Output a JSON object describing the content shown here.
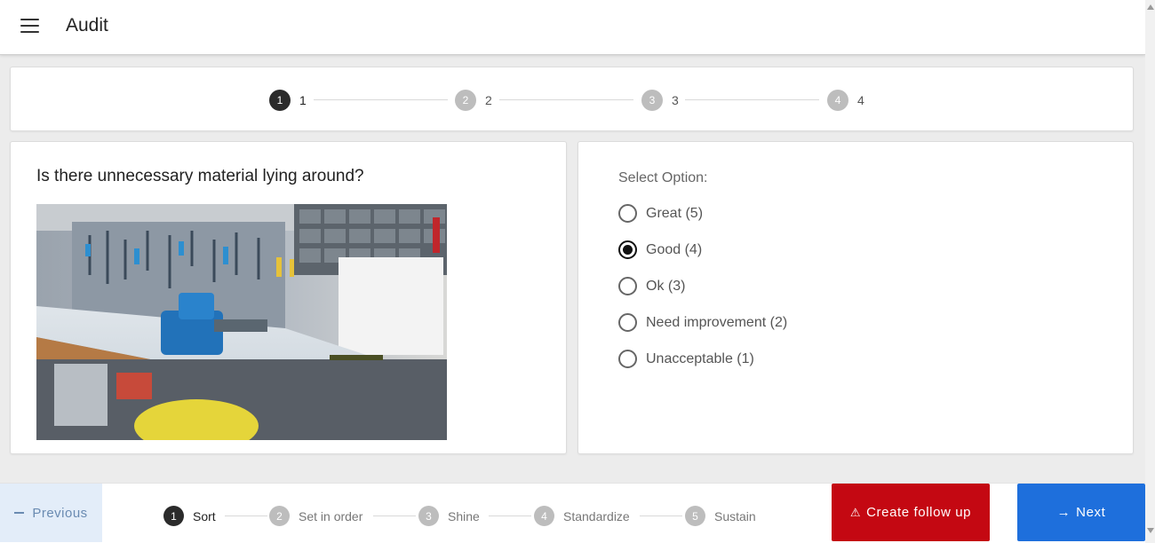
{
  "app": {
    "title": "Audit"
  },
  "top_stepper": {
    "steps": [
      {
        "number": "1",
        "label": "1",
        "active": true
      },
      {
        "number": "2",
        "label": "2",
        "active": false
      },
      {
        "number": "3",
        "label": "3",
        "active": false
      },
      {
        "number": "4",
        "label": "4",
        "active": false
      }
    ]
  },
  "question": {
    "text": "Is there unnecessary material lying around?",
    "image": "workshop-workbench-photo"
  },
  "options": {
    "title": "Select Option:",
    "items": [
      {
        "label": "Great (5)",
        "checked": false
      },
      {
        "label": "Good (4)",
        "checked": true
      },
      {
        "label": "Ok (3)",
        "checked": false
      },
      {
        "label": "Need improvement (2)",
        "checked": false
      },
      {
        "label": "Unacceptable (1)",
        "checked": false
      }
    ]
  },
  "bottom": {
    "previous_label": "Previous",
    "follow_up_label": "Create follow up",
    "next_label": "Next",
    "steps": [
      {
        "number": "1",
        "label": "Sort",
        "active": true
      },
      {
        "number": "2",
        "label": "Set in order",
        "active": false
      },
      {
        "number": "3",
        "label": "Shine",
        "active": false
      },
      {
        "number": "4",
        "label": "Standardize",
        "active": false
      },
      {
        "number": "5",
        "label": "Sustain",
        "active": false
      }
    ]
  },
  "colors": {
    "follow_up": "#c40812",
    "next": "#1e6fdc",
    "previous_bg": "#e3edf9",
    "active_step": "#2b2b2b",
    "inactive_step": "#bdbdbd"
  },
  "icons": {
    "menu": "hamburger-menu-icon",
    "follow_up": "warning-icon",
    "next": "arrow-right-icon",
    "previous": "minus-icon"
  }
}
